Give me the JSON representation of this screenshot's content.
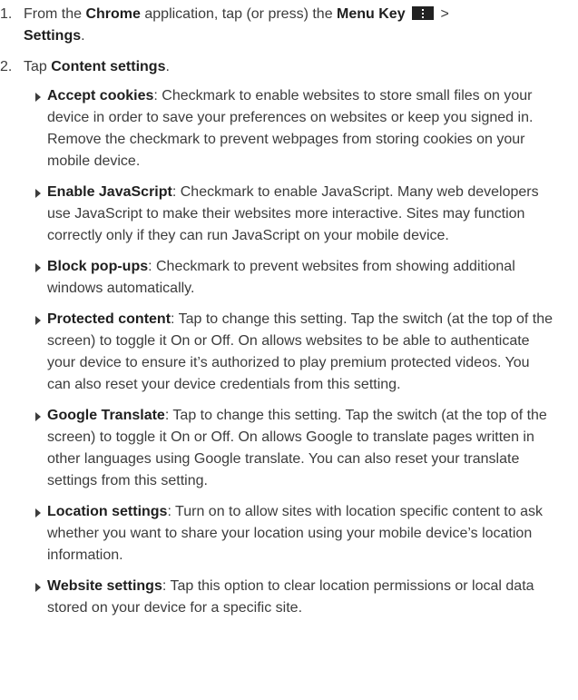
{
  "steps": [
    {
      "number": "1.",
      "prefix": "From the ",
      "app": "Chrome",
      "mid": " application, tap (or press) the ",
      "key": "Menu Key",
      "separator": " > ",
      "target": "Settings",
      "suffix": "."
    },
    {
      "number": "2.",
      "prefix": "Tap ",
      "target": "Content settings",
      "suffix": "."
    }
  ],
  "settings": [
    {
      "title": "Accept cookies",
      "description": ": Checkmark to enable websites to store small files on your device in order to save your preferences on websites or keep you signed in. Remove the checkmark to prevent webpages from storing cookies on your mobile device."
    },
    {
      "title": "Enable JavaScript",
      "description": ": Checkmark to enable JavaScript. Many web developers use JavaScript to make their websites more interactive. Sites may function correctly only if they can run JavaScript on your mobile device."
    },
    {
      "title": "Block pop-ups",
      "description": ": Checkmark to prevent websites from showing additional windows automatically."
    },
    {
      "title": "Protected content",
      "description": ": Tap to change this setting. Tap the switch (at the top of the screen) to toggle it On or Off. On allows websites to be able to authenticate your device to ensure it’s authorized to play premium protected videos. You can also reset your device credentials from this setting."
    },
    {
      "title": "Google Translate",
      "description": ": Tap to change this setting. Tap the switch (at the top of the screen) to toggle it On or Off. On allows Google to translate pages written in other languages using Google translate. You can also reset your translate settings from this setting."
    },
    {
      "title": "Location settings",
      "description": ": Turn on to allow sites with location specific content to ask whether you want to share your location using your mobile device’s location information."
    },
    {
      "title": "Website settings",
      "description": ": Tap this option to clear location permissions or local data stored on your device for a specific site."
    }
  ],
  "icons": {
    "menu_key": "menu-key-icon",
    "bullet": "triangle-right-icon"
  },
  "colors": {
    "text": "#3c3c3c",
    "bold": "#1f1f1f",
    "menu_key_bg": "#222222"
  }
}
